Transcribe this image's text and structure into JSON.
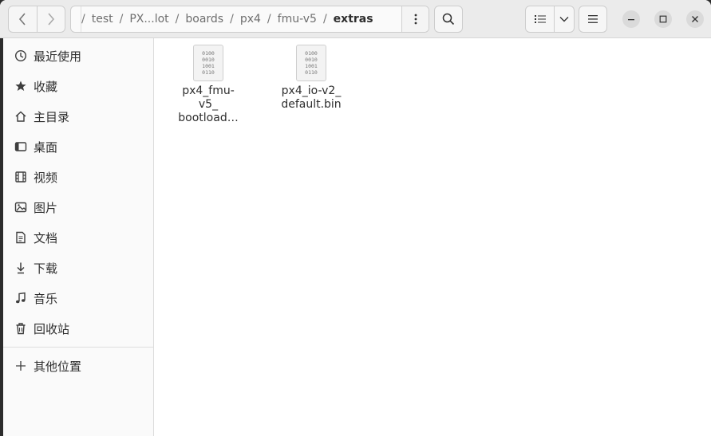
{
  "header": {
    "nav": {
      "back_icon": "chevron-left-icon",
      "forward_icon": "chevron-right-icon"
    },
    "path": [
      {
        "label": "test"
      },
      {
        "label": "PX...lot"
      },
      {
        "label": "boards"
      },
      {
        "label": "px4"
      },
      {
        "label": "fmu-v5"
      },
      {
        "label": "extras",
        "current": true
      }
    ],
    "path_separator": "/",
    "path_menu_icon": "vertical-dots-icon",
    "search_icon": "search-icon",
    "view_icon": "list-view-icon",
    "view_dropdown_icon": "chevron-down-icon",
    "menu_icon": "hamburger-menu-icon",
    "window_controls": [
      "minimize-icon",
      "maximize-icon",
      "close-icon"
    ]
  },
  "sidebar": {
    "items": [
      {
        "label": "最近使用",
        "icon": "clock-icon"
      },
      {
        "label": "收藏",
        "icon": "star-icon"
      },
      {
        "label": "主目录",
        "icon": "home-icon"
      },
      {
        "label": "桌面",
        "icon": "desktop-icon"
      },
      {
        "label": "视频",
        "icon": "video-icon"
      },
      {
        "label": "图片",
        "icon": "image-icon"
      },
      {
        "label": "文档",
        "icon": "document-icon"
      },
      {
        "label": "下载",
        "icon": "download-icon"
      },
      {
        "label": "音乐",
        "icon": "music-icon"
      },
      {
        "label": "回收站",
        "icon": "trash-icon"
      }
    ],
    "other": {
      "label": "其他位置",
      "icon": "plus-icon"
    }
  },
  "files": [
    {
      "name_lines": [
        "px4_fmu-",
        "v5_",
        "bootload…"
      ],
      "icon": "binary-file-icon",
      "binary": [
        "0100",
        "0010",
        "1001",
        "0110"
      ]
    },
    {
      "name_lines": [
        "px4_io-v2_",
        "default.bin"
      ],
      "icon": "binary-file-icon",
      "binary": [
        "0100",
        "0010",
        "1001",
        "0110"
      ]
    }
  ]
}
